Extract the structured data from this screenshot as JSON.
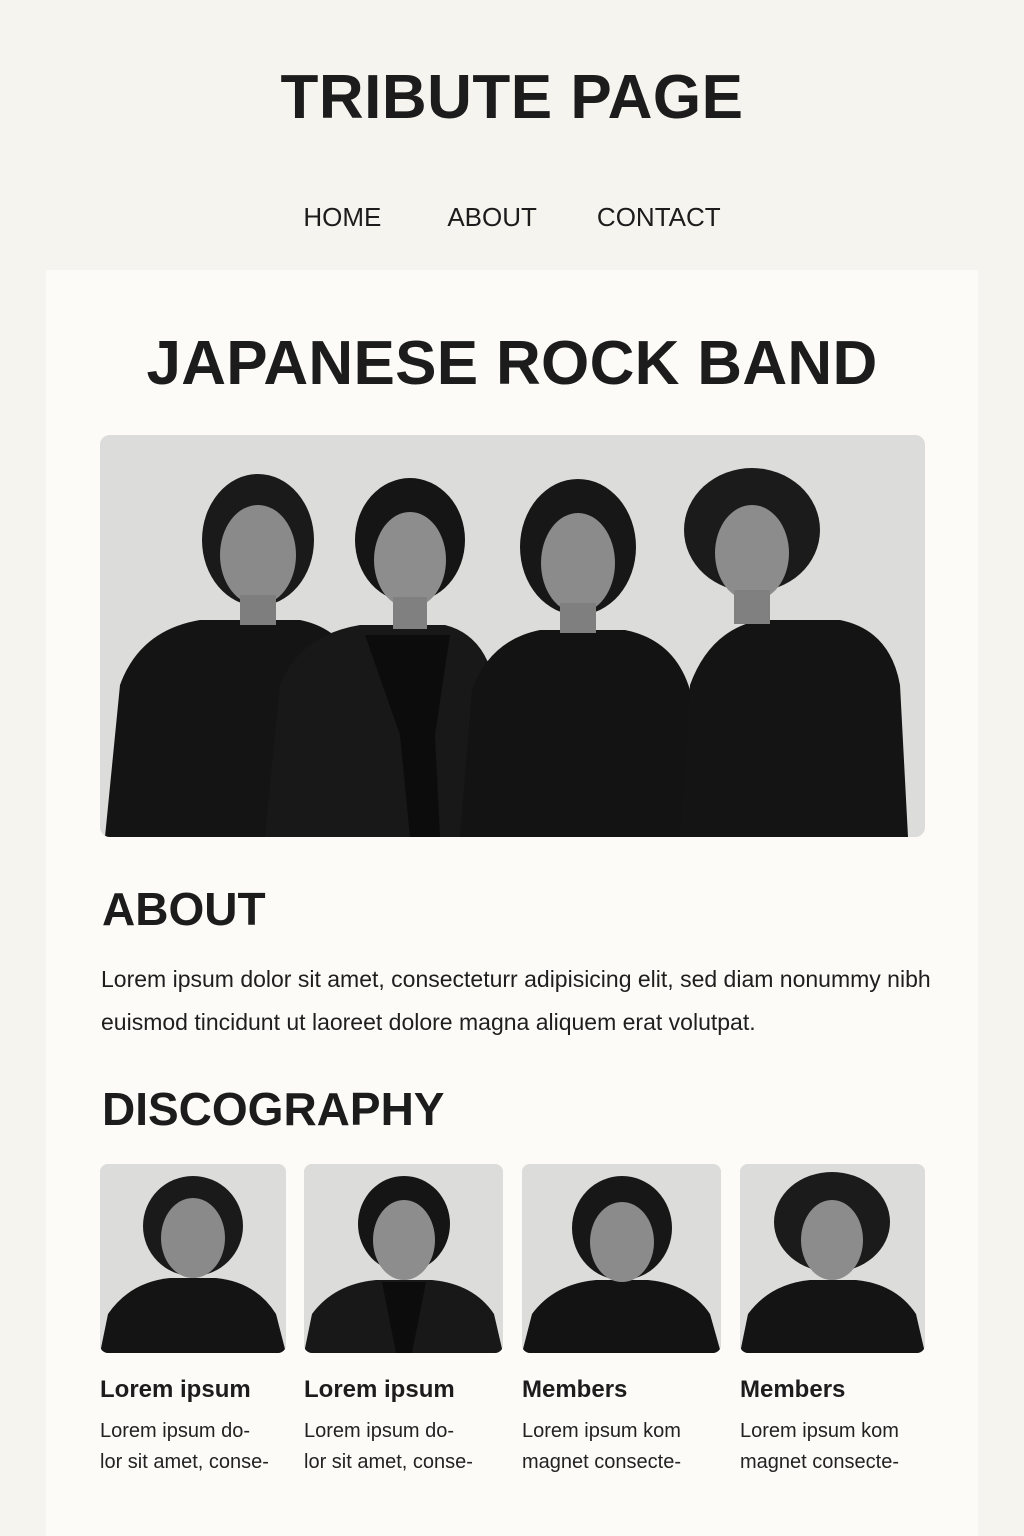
{
  "site": {
    "title": "TRIBUTE PAGE"
  },
  "nav": {
    "items": [
      "HOME",
      "ABOUT",
      "CONTACT"
    ]
  },
  "main": {
    "band_title": "JAPANESE ROCK BAND",
    "hero_image": "band-photo",
    "about": {
      "heading": "ABOUT",
      "text": "Lorem ipsum dolor sit amet, consecteturr adipisicing elit, sed diam nonummy nibh euismod tincidunt ut laoreet dolore magna aliquem erat volutpat."
    },
    "discography": {
      "heading": "DISCOGRAPHY",
      "cards": [
        {
          "title": "Lorem ipsum",
          "text": "Lorem ipsum do-\nlor sit amet, conse-"
        },
        {
          "title": "Lorem ipsum",
          "text": "Lorem ipsum do-\nlor sit amet, conse-"
        },
        {
          "title": "Members",
          "text": "Lorem ipsum kom\nmagnet consecte-"
        },
        {
          "title": "Members",
          "text": "Lorem ipsum kom\nmagnet consecte-"
        }
      ]
    }
  },
  "colors": {
    "page_bg": "#f6f4ef",
    "content_bg": "#fcfbf8",
    "text": "#1c1c1c",
    "photo_bg": "#dededd"
  }
}
